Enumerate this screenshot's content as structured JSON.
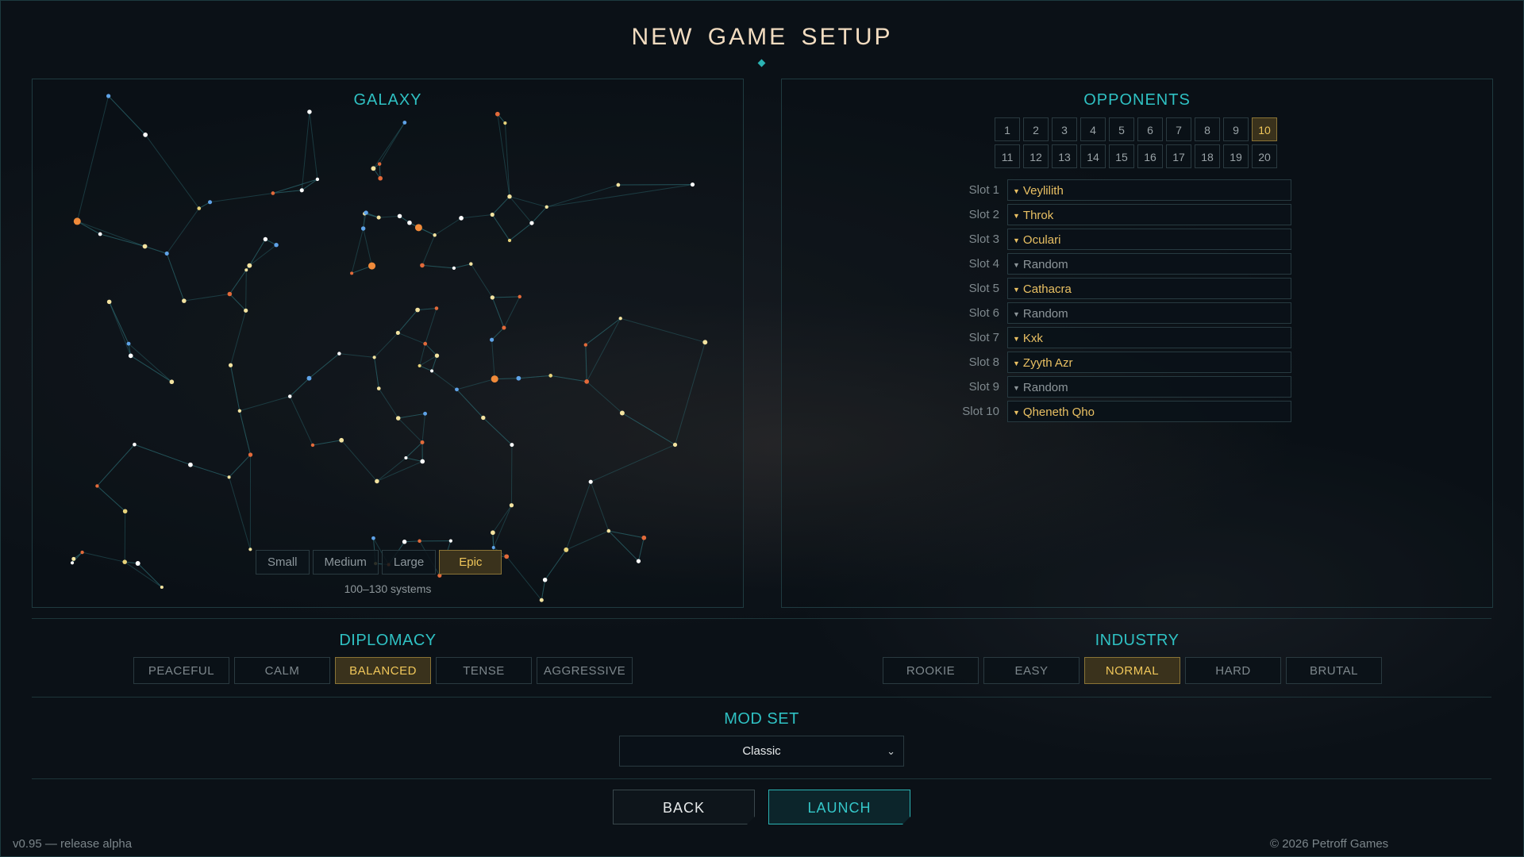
{
  "title": "NEW GAME SETUP",
  "galaxy": {
    "heading": "GALAXY",
    "sizes": [
      "Small",
      "Medium",
      "Large",
      "Epic"
    ],
    "selected_size": "Epic",
    "size_note": "100–130 systems"
  },
  "opponents": {
    "heading": "OPPONENTS",
    "counts": [
      "1",
      "2",
      "3",
      "4",
      "5",
      "6",
      "7",
      "8",
      "9",
      "10",
      "11",
      "12",
      "13",
      "14",
      "15",
      "16",
      "17",
      "18",
      "19",
      "20"
    ],
    "selected_count": "10",
    "slots": [
      {
        "label": "Slot 1",
        "value": "Veylilith"
      },
      {
        "label": "Slot 2",
        "value": "Throk"
      },
      {
        "label": "Slot 3",
        "value": "Oculari"
      },
      {
        "label": "Slot 4",
        "value": "Random"
      },
      {
        "label": "Slot 5",
        "value": "Cathacra"
      },
      {
        "label": "Slot 6",
        "value": "Random"
      },
      {
        "label": "Slot 7",
        "value": "Kxk"
      },
      {
        "label": "Slot 8",
        "value": "Zyyth Azr"
      },
      {
        "label": "Slot 9",
        "value": "Random"
      },
      {
        "label": "Slot 10",
        "value": "Qheneth Qho"
      }
    ]
  },
  "diplomacy": {
    "heading": "DIPLOMACY",
    "options": [
      "PEACEFUL",
      "CALM",
      "BALANCED",
      "TENSE",
      "AGGRESSIVE"
    ],
    "selected": "BALANCED"
  },
  "industry": {
    "heading": "INDUSTRY",
    "options": [
      "ROOKIE",
      "EASY",
      "NORMAL",
      "HARD",
      "BRUTAL"
    ],
    "selected": "NORMAL"
  },
  "mod_set": {
    "heading": "MOD SET",
    "value": "Classic"
  },
  "actions": {
    "back": "BACK",
    "launch": "LAUNCH"
  },
  "footer": {
    "version": "v0.95 — release alpha",
    "copyright": "© 2026 Petroff Games"
  },
  "colors": {
    "accent": "#2fc1c3",
    "selected": "#f0c75a",
    "title": "#f2dcc0"
  }
}
